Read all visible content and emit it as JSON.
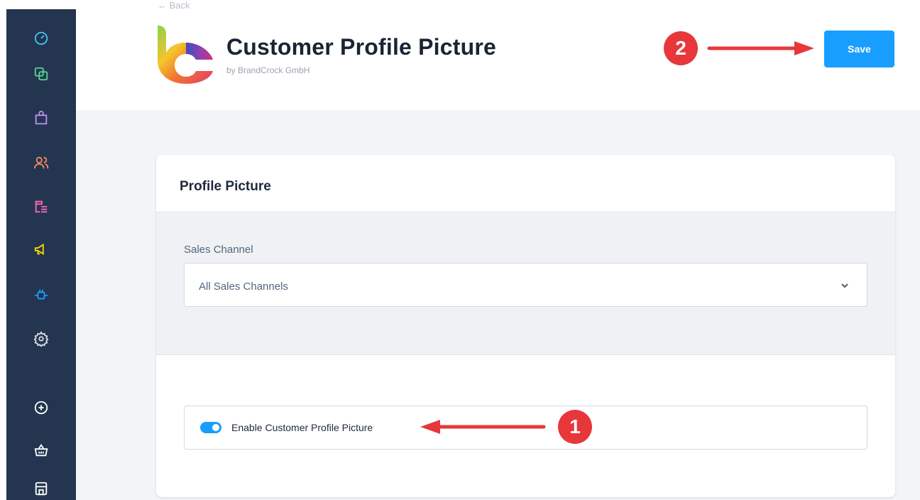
{
  "header": {
    "back_label": "← Back",
    "title": "Customer Profile Picture",
    "subtitle": "by BrandCrock GmbH",
    "save_label": "Save"
  },
  "sidebar": {
    "items": [
      {
        "icon": "dashboard-icon",
        "color": "#45c4f5"
      },
      {
        "icon": "catalogues-icon",
        "color": "#57d58f"
      },
      {
        "icon": "orders-icon",
        "color": "#c58cf7"
      },
      {
        "icon": "customers-icon",
        "color": "#f88962"
      },
      {
        "icon": "content-icon",
        "color": "#ff68b4"
      },
      {
        "icon": "marketing-icon",
        "color": "#ffd700"
      },
      {
        "icon": "extensions-icon",
        "color": "#189eff"
      },
      {
        "icon": "settings-icon",
        "color": "#d7dce3"
      },
      {
        "icon": "add-icon",
        "color": "#ffffff"
      },
      {
        "icon": "basket-icon",
        "color": "#ffffff"
      },
      {
        "icon": "store-icon",
        "color": "#ffffff"
      }
    ]
  },
  "card": {
    "title": "Profile Picture",
    "sales_channel_label": "Sales Channel",
    "sales_channel_value": "All Sales Channels",
    "enable_label": "Enable Customer Profile Picture",
    "enable_on": true
  },
  "annotations": {
    "one": "1",
    "two": "2",
    "color": "#e8373b"
  },
  "colors": {
    "accent": "#189eff",
    "sidebar": "#243550"
  }
}
